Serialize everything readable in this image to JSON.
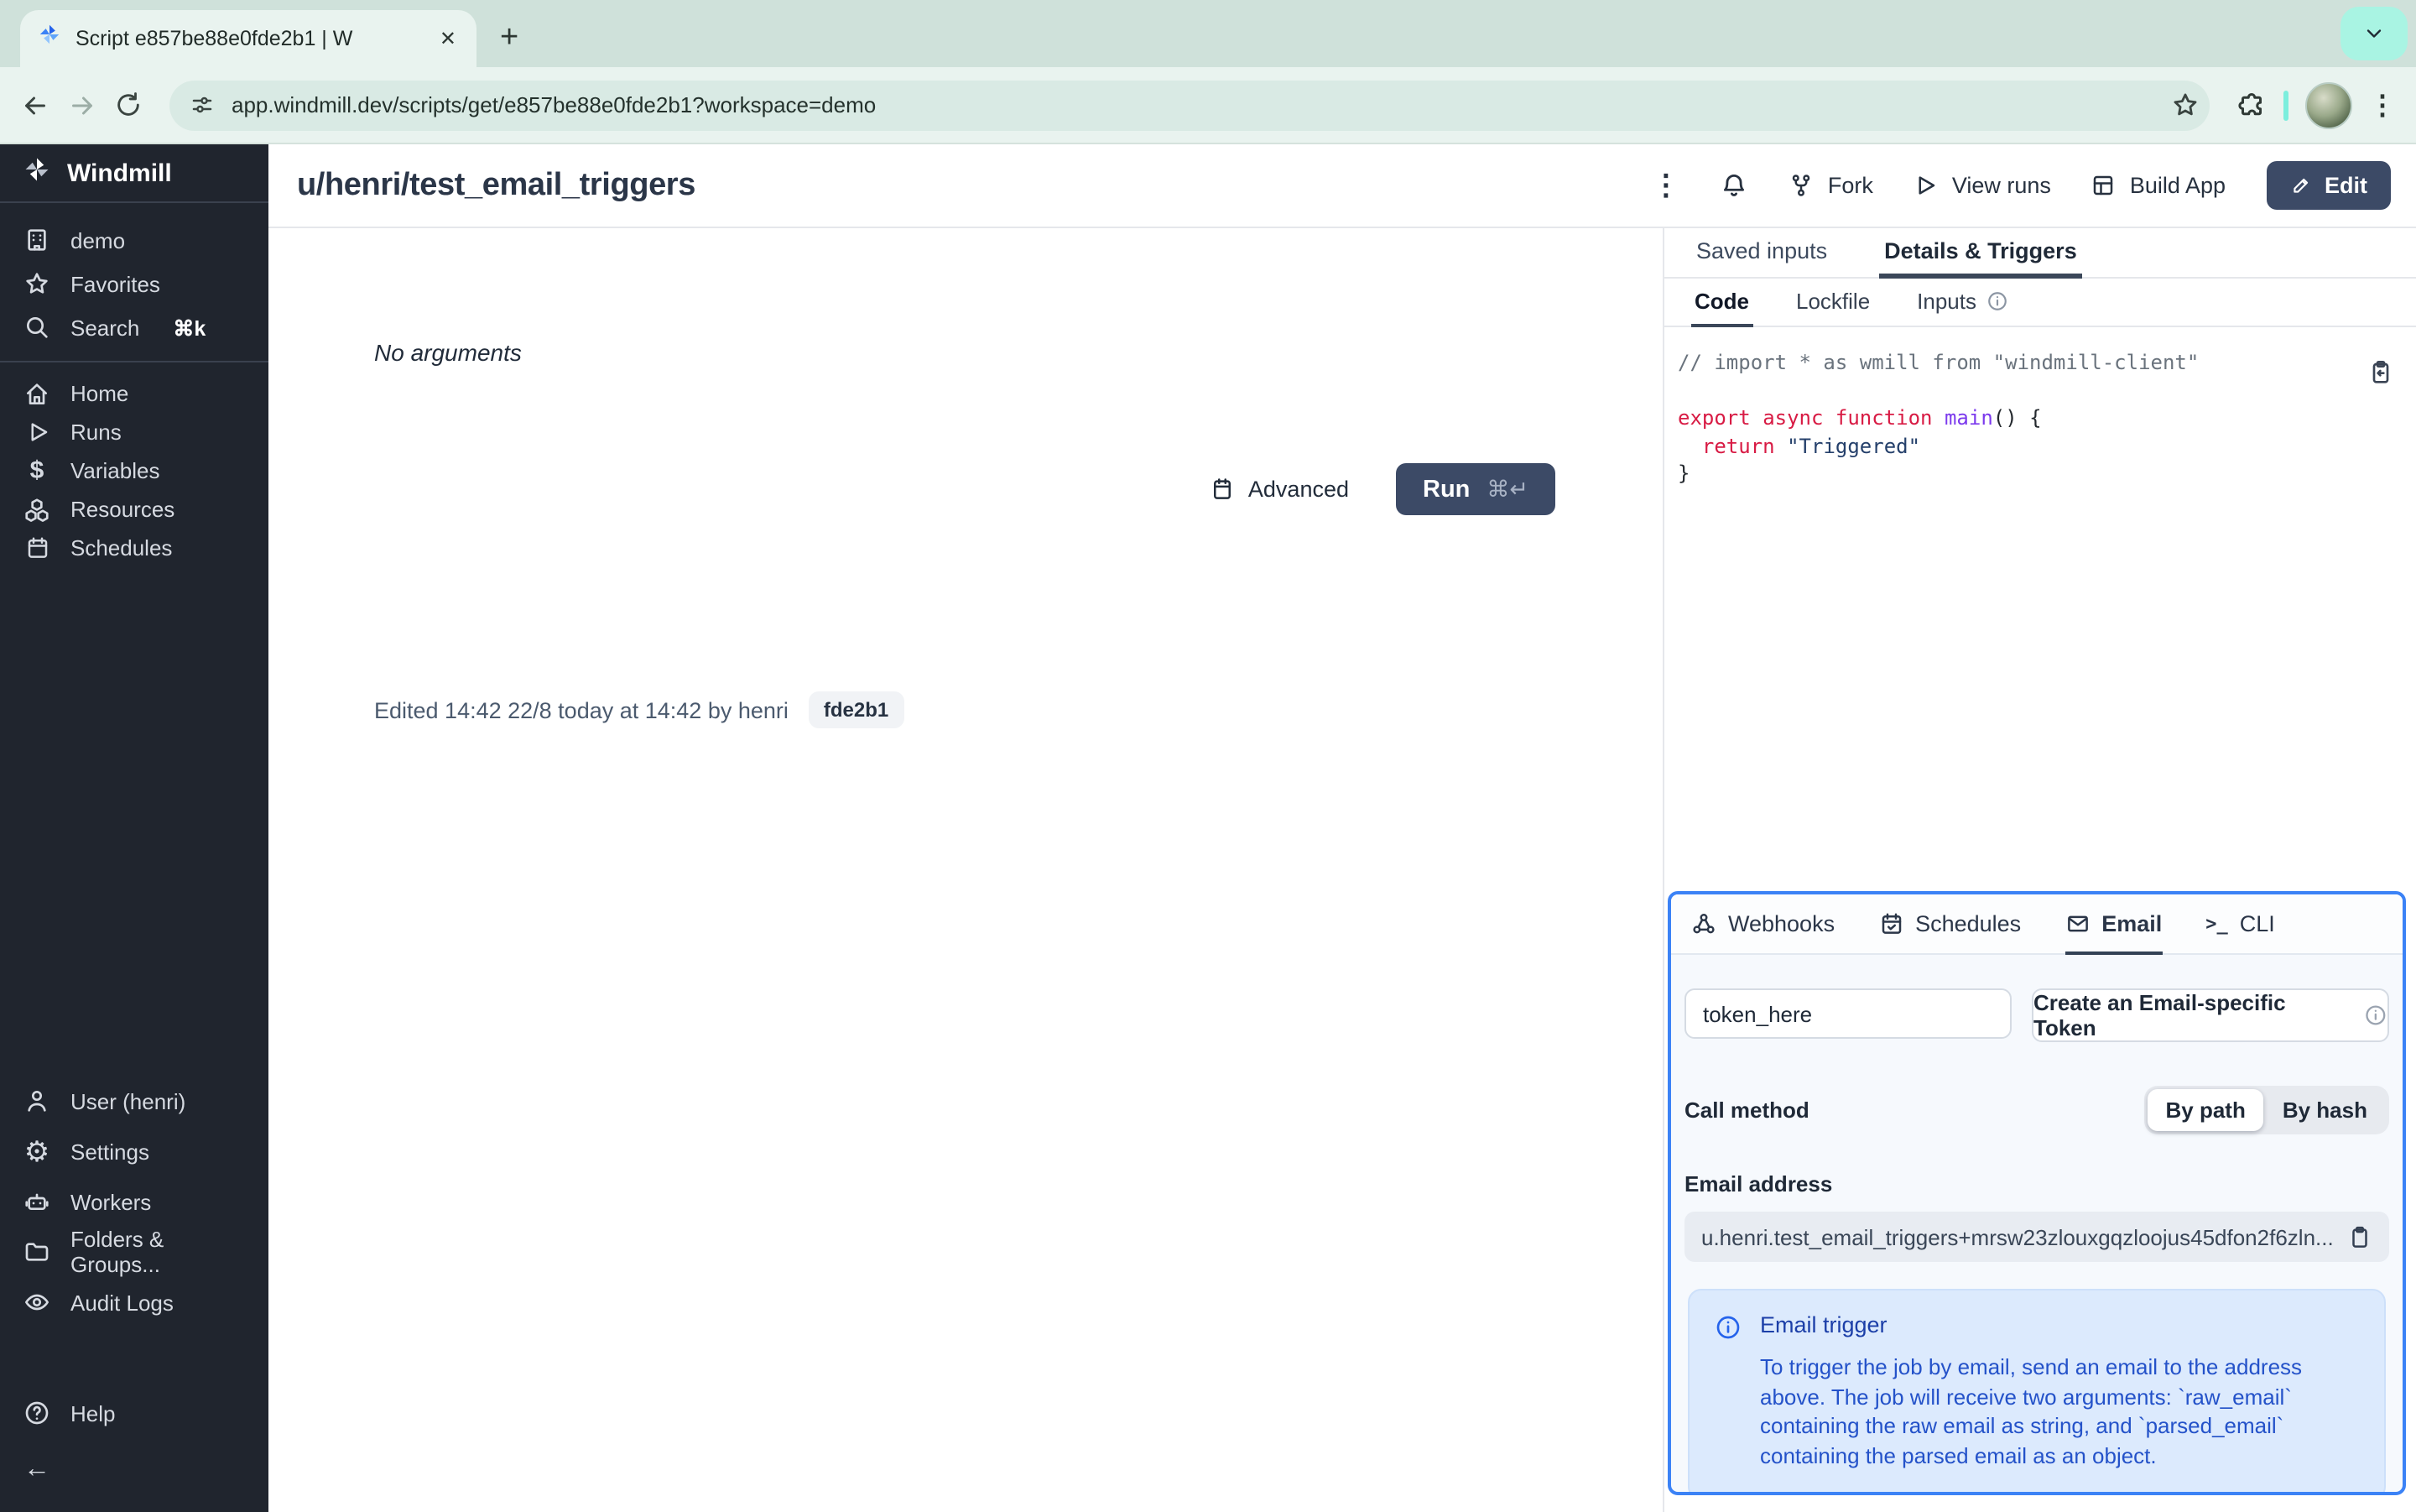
{
  "browser": {
    "tab_title": "Script e857be88e0fde2b1 | W",
    "url": "app.windmill.dev/scripts/get/e857be88e0fde2b1?workspace=demo"
  },
  "icons": {
    "kebab": "⋮",
    "plus": "+",
    "close": "✕",
    "gear": "⚙",
    "dollar": "$",
    "back_arrow": "←",
    "terminal_prompt": ">_",
    "chevron_down": "⌄"
  },
  "sidebar": {
    "brand": "Windmill",
    "workspace": "demo",
    "favorites": "Favorites",
    "search": "Search",
    "search_shortcut": "⌘k",
    "menu": [
      "Home",
      "Runs",
      "Variables",
      "Resources",
      "Schedules"
    ],
    "bottom": [
      "User (henri)",
      "Settings",
      "Workers",
      "Folders & Groups...",
      "Audit Logs"
    ],
    "help": "Help"
  },
  "header": {
    "title": "u/henri/test_email_triggers",
    "fork": "Fork",
    "view_runs": "View runs",
    "build_app": "Build App",
    "edit": "Edit"
  },
  "main": {
    "no_arguments": "No arguments",
    "advanced": "Advanced",
    "run": "Run",
    "run_shortcut": "⌘↵",
    "edited": "Edited 14:42 22/8 today at 14:42 by henri",
    "version_badge": "fde2b1"
  },
  "details_panel": {
    "tabs": [
      "Saved inputs",
      "Details & Triggers"
    ],
    "active_tab": "Details & Triggers",
    "subtabs": [
      "Code",
      "Lockfile",
      "Inputs"
    ],
    "active_subtab": "Code",
    "code": {
      "comment": "// import * as wmill from \"windmill-client\"",
      "k_export": "export",
      "k_async": "async",
      "k_function": "function",
      "fn": "main",
      "sig": "() {",
      "k_return": "return",
      "str": "\"Triggered\"",
      "brace": "}"
    }
  },
  "triggers_panel": {
    "tabs": [
      "Webhooks",
      "Schedules",
      "Email",
      "CLI"
    ],
    "active_tab": "Email",
    "token_value": "token_here",
    "create_token": "Create an Email-specific Token",
    "call_method_label": "Call method",
    "by_path": "By path",
    "by_hash": "By hash",
    "selected_call_method": "By path",
    "email_address_label": "Email address",
    "email_address": "u.henri.test_email_triggers+mrsw23zlouxgqzloojus45dfon2f6zln...",
    "info": {
      "title": "Email trigger",
      "body": "To trigger the job by email, send an email to the address above. The job will receive two arguments: `raw_email` containing the raw email as string, and `parsed_email` containing the parsed email as an object."
    }
  },
  "colors": {
    "accent_blue": "#3b82f6",
    "primary_button": "#3c4a66",
    "sidebar_bg": "#20252e",
    "chrome_tabstrip": "#cfe1da",
    "chrome_toolbar": "#e9f3ef",
    "info_box_bg": "#dceafd",
    "code_keyword": "#d81b44",
    "code_function": "#7c3aed",
    "code_string": "#25406b",
    "code_comment": "#6a737d"
  }
}
